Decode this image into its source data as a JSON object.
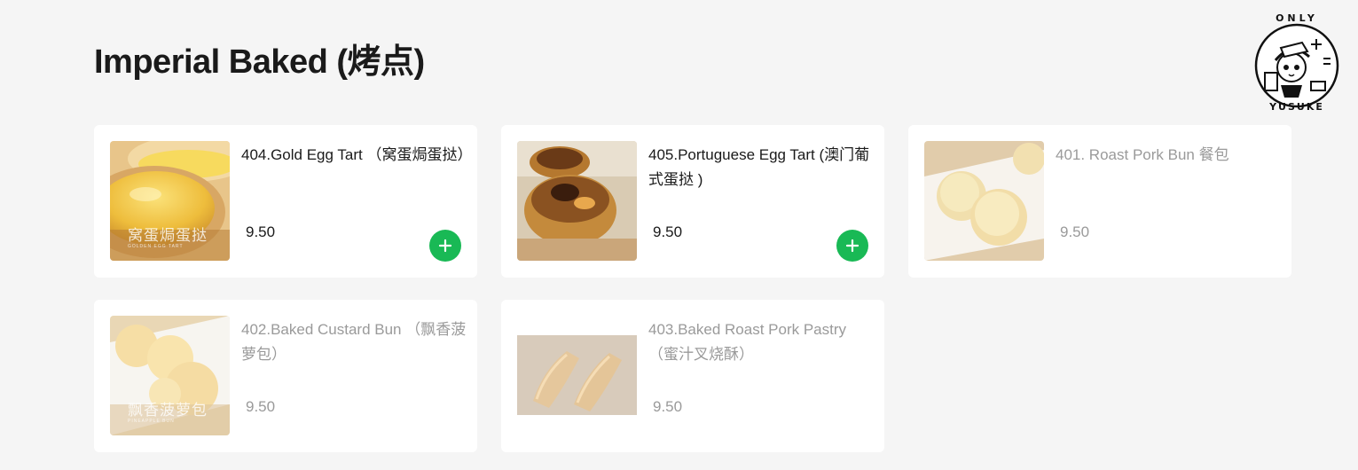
{
  "header": {
    "title": "Imperial Baked (烤点)"
  },
  "logo": {
    "top_text": "ONLY",
    "bottom_text": "YUSUKE",
    "icon": "only-yusuke-logo-icon"
  },
  "colors": {
    "accent": "#19b955",
    "text": "#1a1a1a",
    "disabled_text": "#9a9a9a",
    "background": "#f5f5f5",
    "card": "#ffffff"
  },
  "items": [
    {
      "name": "404.Gold Egg Tart （窝蛋焗蛋挞）",
      "price": "9.50",
      "available": true,
      "thumb_caption": "窝蛋焗蛋挞",
      "thumb_subcaption": "GOLDEN EGG TART",
      "add_icon": "plus-icon"
    },
    {
      "name": "405.Portuguese Egg Tart (澳门葡式蛋挞 )",
      "price": "9.50",
      "available": true,
      "thumb_caption": "",
      "thumb_subcaption": "",
      "add_icon": "plus-icon"
    },
    {
      "name": "401. Roast Pork Bun 餐包",
      "price": "9.50",
      "available": false,
      "thumb_caption": "",
      "thumb_subcaption": ""
    },
    {
      "name": "402.Baked Custard Bun （飘香菠萝包）",
      "price": "9.50",
      "available": false,
      "thumb_caption": "飘香菠萝包",
      "thumb_subcaption": "PINEAPPLE BUN"
    },
    {
      "name": "403.Baked Roast Pork Pastry（蜜汁叉烧酥）",
      "price": "9.50",
      "available": false,
      "thumb_caption": "",
      "thumb_subcaption": ""
    }
  ]
}
